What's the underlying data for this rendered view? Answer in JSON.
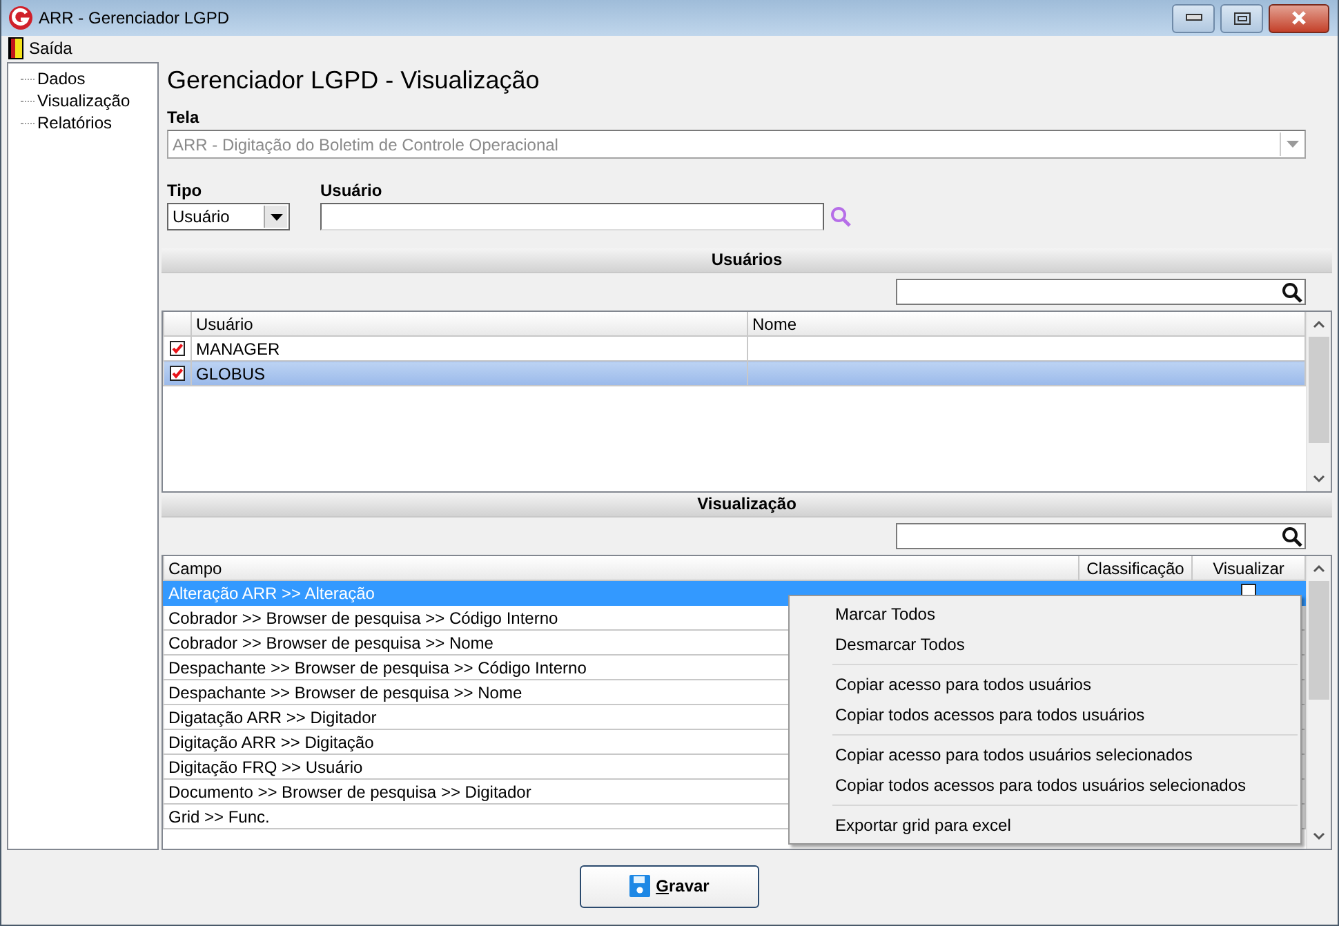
{
  "window": {
    "title": "ARR - Gerenciador LGPD"
  },
  "menu": [
    {
      "label": "Saída"
    }
  ],
  "sidebar": {
    "items": [
      {
        "label": "Dados"
      },
      {
        "label": "Visualização"
      },
      {
        "label": "Relatórios"
      }
    ]
  },
  "heading": "Gerenciador LGPD - Visualização",
  "tela": {
    "label": "Tela",
    "value": "ARR - Digitação do Boletim de Controle Operacional",
    "disabled": true
  },
  "tipo": {
    "label": "Tipo",
    "value": "Usuário"
  },
  "usuario": {
    "label": "Usuário"
  },
  "usuarios": {
    "title": "Usuários",
    "columns": [
      "Usuário",
      "Nome"
    ],
    "rows": [
      {
        "checked": true,
        "usuario": "MANAGER",
        "selected": false
      },
      {
        "checked": true,
        "usuario": "GLOBUS",
        "selected": true
      }
    ]
  },
  "visualizacao": {
    "title": "Visualização",
    "columns": [
      "Campo",
      "Classificação",
      "Visualizar"
    ],
    "rows": [
      {
        "campo": "Alteração ARR >> Alteração",
        "visualizar": false,
        "selected": true
      },
      {
        "campo": "Cobrador >> Browser de pesquisa >> Código Interno",
        "selected": false
      },
      {
        "campo": "Cobrador >> Browser de pesquisa >> Nome",
        "selected": false
      },
      {
        "campo": "Despachante >> Browser de pesquisa >> Código Interno",
        "selected": false
      },
      {
        "campo": "Despachante >> Browser de pesquisa >> Nome",
        "selected": false
      },
      {
        "campo": "Digatação ARR >> Digitador",
        "selected": false
      },
      {
        "campo": "Digitação ARR >> Digitação",
        "selected": false
      },
      {
        "campo": "Digitação FRQ >> Usuário",
        "selected": false
      },
      {
        "campo": "Documento >> Browser de pesquisa >> Digitador",
        "selected": false
      },
      {
        "campo": "Grid >> Func.",
        "selected": false
      }
    ]
  },
  "context_menu": {
    "groups": [
      [
        "Marcar Todos",
        "Desmarcar Todos"
      ],
      [
        "Copiar acesso para todos usuários",
        "Copiar todos acessos para todos usuários"
      ],
      [
        "Copiar acesso para todos usuários selecionados",
        "Copiar todos acessos para todos usuários selecionados"
      ],
      [
        "Exportar grid para excel"
      ]
    ]
  },
  "save_button": {
    "label": "Gravar"
  }
}
